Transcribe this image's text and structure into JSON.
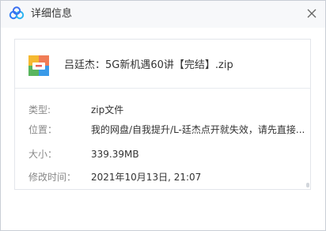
{
  "window": {
    "title": "详细信息"
  },
  "file": {
    "name": "吕廷杰：5G新机遇60讲【完结】.zip",
    "icon": "zip-archive-icon"
  },
  "details": [
    {
      "label": "类型:",
      "value": "zip文件"
    },
    {
      "label": "位置：",
      "value": "我的网盘/自我提升/L-廷杰点开就失效，请先直接..."
    },
    {
      "label": "大小：",
      "value": "339.39MB"
    },
    {
      "label": "修改时间：",
      "value": "2021年10月13日, 21:07"
    }
  ],
  "colors": {
    "brand_blue": "#3a7df0",
    "label_gray": "#888888",
    "text": "#333333"
  }
}
